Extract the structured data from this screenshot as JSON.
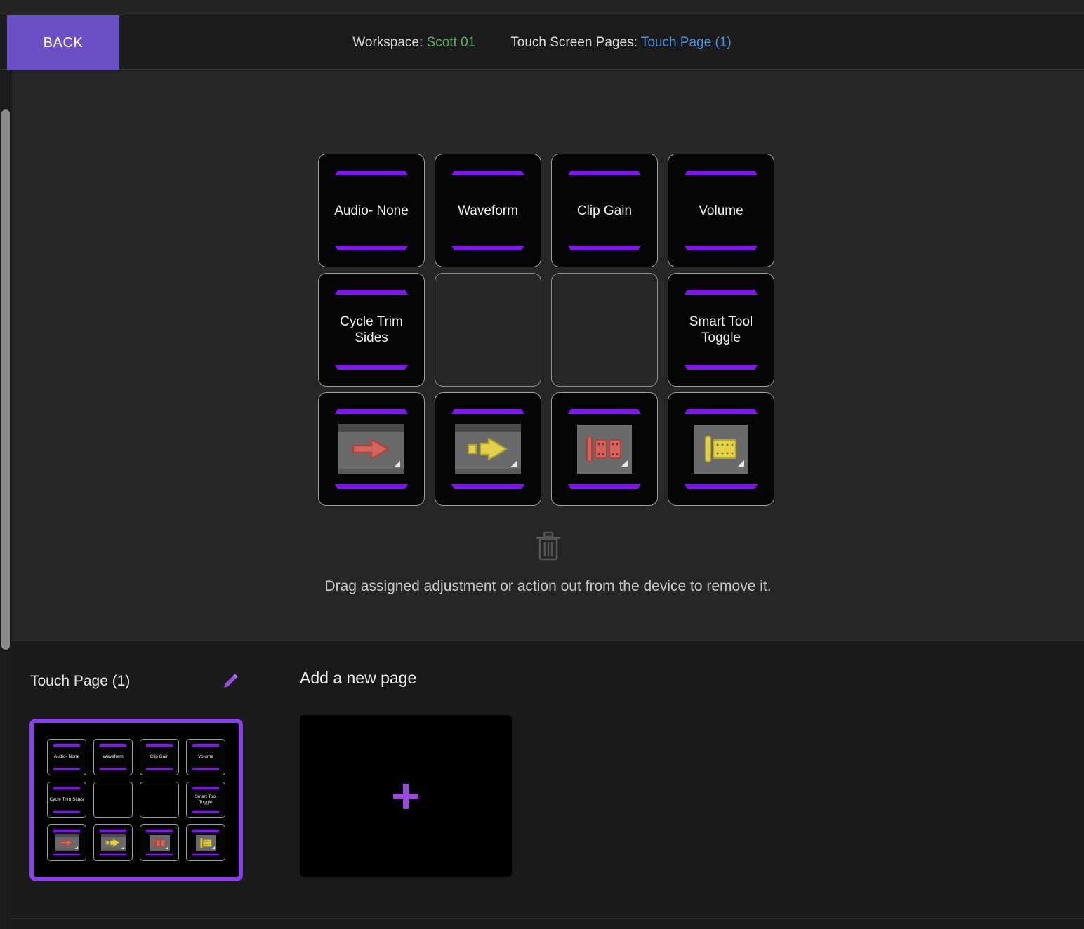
{
  "top_strip": {
    "present": true
  },
  "header": {
    "back_label": "BACK",
    "workspace_label": "Workspace:",
    "workspace_value": "Scott 01",
    "pages_label": "Touch Screen Pages:",
    "pages_value": "Touch Page (1)",
    "back_color": "#6b4fc4",
    "workspace_value_color": "#5fa86a",
    "pages_value_color": "#4a90e2"
  },
  "editor": {
    "accent_color": "#7d19e8",
    "pads": [
      {
        "id": "pad-1",
        "type": "label",
        "label": "Audio- None",
        "assigned": true
      },
      {
        "id": "pad-2",
        "type": "label",
        "label": "Waveform",
        "assigned": true
      },
      {
        "id": "pad-3",
        "type": "label",
        "label": "Clip Gain",
        "assigned": true
      },
      {
        "id": "pad-4",
        "type": "label",
        "label": "Volume",
        "assigned": true
      },
      {
        "id": "pad-5",
        "type": "label",
        "label": "Cycle Trim Sides",
        "assigned": true
      },
      {
        "id": "pad-6",
        "type": "empty",
        "label": "",
        "assigned": false
      },
      {
        "id": "pad-7",
        "type": "empty",
        "label": "",
        "assigned": false
      },
      {
        "id": "pad-8",
        "type": "label",
        "label": "Smart Tool Toggle",
        "assigned": true
      },
      {
        "id": "pad-9",
        "type": "icon",
        "icon": "red-arrow-right-icon",
        "label": "",
        "assigned": true
      },
      {
        "id": "pad-10",
        "type": "icon",
        "icon": "yellow-arrow-right-icon",
        "label": "",
        "assigned": true
      },
      {
        "id": "pad-11",
        "type": "icon",
        "icon": "red-trim-clips-icon",
        "label": "",
        "assigned": true
      },
      {
        "id": "pad-12",
        "type": "icon",
        "icon": "yellow-trim-clip-icon",
        "label": "",
        "assigned": true
      }
    ],
    "trash_icon": "trash-icon",
    "hint": "Drag assigned adjustment or action out from the device to remove it."
  },
  "pages": {
    "current_page_name": "Touch Page (1)",
    "edit_icon": "pencil-icon",
    "add_page_title": "Add a new page",
    "add_icon": "plus-icon",
    "thumb_border_color": "#8b3fe8"
  },
  "scrollbar": {
    "orientation": "vertical",
    "position": "left"
  }
}
